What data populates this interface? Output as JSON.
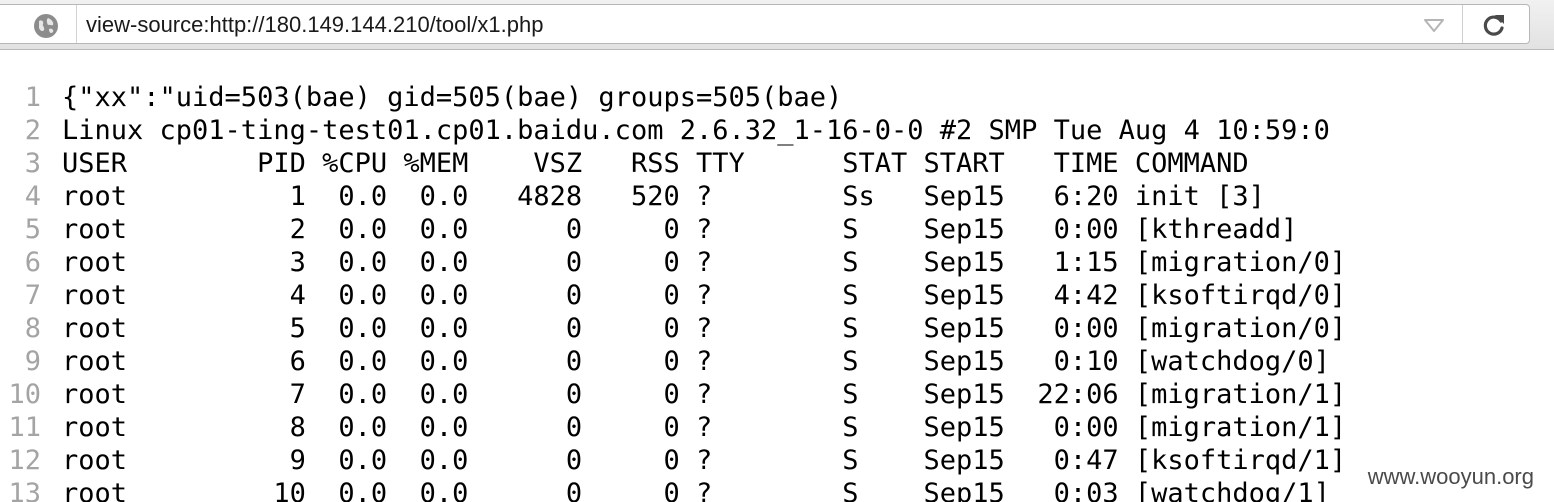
{
  "browser": {
    "url": "view-source:http://180.149.144.210/tool/x1.php",
    "icons": {
      "site": "globe-icon",
      "history": "dropdown-arrow-icon",
      "reload": "reload-icon"
    }
  },
  "source_lines": [
    {
      "n": "1",
      "text": "{\"xx\":\"uid=503(bae) gid=505(bae) groups=505(bae)"
    },
    {
      "n": "2",
      "text": "Linux cp01-ting-test01.cp01.baidu.com 2.6.32_1-16-0-0 #2 SMP Tue Aug 4 10:59:0"
    },
    {
      "n": "3",
      "text": "USER        PID %CPU %MEM    VSZ   RSS TTY      STAT START   TIME COMMAND"
    },
    {
      "n": "4",
      "text": "root          1  0.0  0.0   4828   520 ?        Ss   Sep15   6:20 init [3]"
    },
    {
      "n": "5",
      "text": "root          2  0.0  0.0      0     0 ?        S    Sep15   0:00 [kthreadd]"
    },
    {
      "n": "6",
      "text": "root          3  0.0  0.0      0     0 ?        S    Sep15   1:15 [migration/0]"
    },
    {
      "n": "7",
      "text": "root          4  0.0  0.0      0     0 ?        S    Sep15   4:42 [ksoftirqd/0]"
    },
    {
      "n": "8",
      "text": "root          5  0.0  0.0      0     0 ?        S    Sep15   0:00 [migration/0]"
    },
    {
      "n": "9",
      "text": "root          6  0.0  0.0      0     0 ?        S    Sep15   0:10 [watchdog/0]"
    },
    {
      "n": "10",
      "text": "root          7  0.0  0.0      0     0 ?        S    Sep15  22:06 [migration/1]"
    },
    {
      "n": "11",
      "text": "root          8  0.0  0.0      0     0 ?        S    Sep15   0:00 [migration/1]"
    },
    {
      "n": "12",
      "text": "root          9  0.0  0.0      0     0 ?        S    Sep15   0:47 [ksoftirqd/1]"
    },
    {
      "n": "13",
      "text": "root         10  0.0  0.0      0     0 ?        S    Sep15   0:03 [watchdog/1]"
    }
  ],
  "watermark": "www.wooyun.org",
  "colors": {
    "line_number": "#a4a4a4",
    "text": "#000000",
    "toolbar": "#e8e8e8"
  }
}
